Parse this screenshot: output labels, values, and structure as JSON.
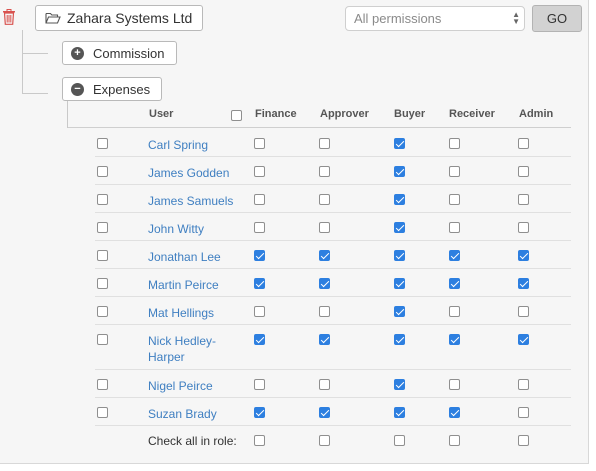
{
  "company": {
    "name": "Zahara Systems Ltd"
  },
  "filter": {
    "selected": "All permissions"
  },
  "go_label": "GO",
  "groups": [
    {
      "label": "Commission",
      "state": "collapsed"
    },
    {
      "label": "Expenses",
      "state": "expanded"
    }
  ],
  "table": {
    "headers": {
      "user": "User",
      "finance": "Finance",
      "approver": "Approver",
      "buyer": "Buyer",
      "receiver": "Receiver",
      "admin": "Admin"
    },
    "rows": [
      {
        "name": "Carl Spring",
        "finance": false,
        "approver": false,
        "buyer": true,
        "receiver": false,
        "admin": false
      },
      {
        "name": "James Godden",
        "finance": false,
        "approver": false,
        "buyer": true,
        "receiver": false,
        "admin": false
      },
      {
        "name": "James Samuels",
        "finance": false,
        "approver": false,
        "buyer": true,
        "receiver": false,
        "admin": false
      },
      {
        "name": "John Witty",
        "finance": false,
        "approver": false,
        "buyer": true,
        "receiver": false,
        "admin": false
      },
      {
        "name": "Jonathan Lee",
        "finance": true,
        "approver": true,
        "buyer": true,
        "receiver": true,
        "admin": true
      },
      {
        "name": "Martin  Peirce",
        "finance": true,
        "approver": true,
        "buyer": true,
        "receiver": true,
        "admin": true
      },
      {
        "name": "Mat Hellings",
        "finance": false,
        "approver": false,
        "buyer": true,
        "receiver": false,
        "admin": false
      },
      {
        "name": "Nick Hedley-Harper",
        "finance": true,
        "approver": true,
        "buyer": true,
        "receiver": true,
        "admin": true
      },
      {
        "name": "Nigel Peirce",
        "finance": false,
        "approver": false,
        "buyer": true,
        "receiver": false,
        "admin": false
      },
      {
        "name": "Suzan Brady",
        "finance": true,
        "approver": true,
        "buyer": true,
        "receiver": true,
        "admin": false
      }
    ],
    "footer_label": "Check all in role:"
  },
  "colors": {
    "link": "#3f7fc1",
    "checked": "#2d7fe0",
    "danger": "#d9534f"
  },
  "icons": {
    "delete": "trash-icon",
    "company": "folder-open-icon",
    "collapsed": "plus-circle-icon",
    "expanded": "minus-circle-icon"
  }
}
